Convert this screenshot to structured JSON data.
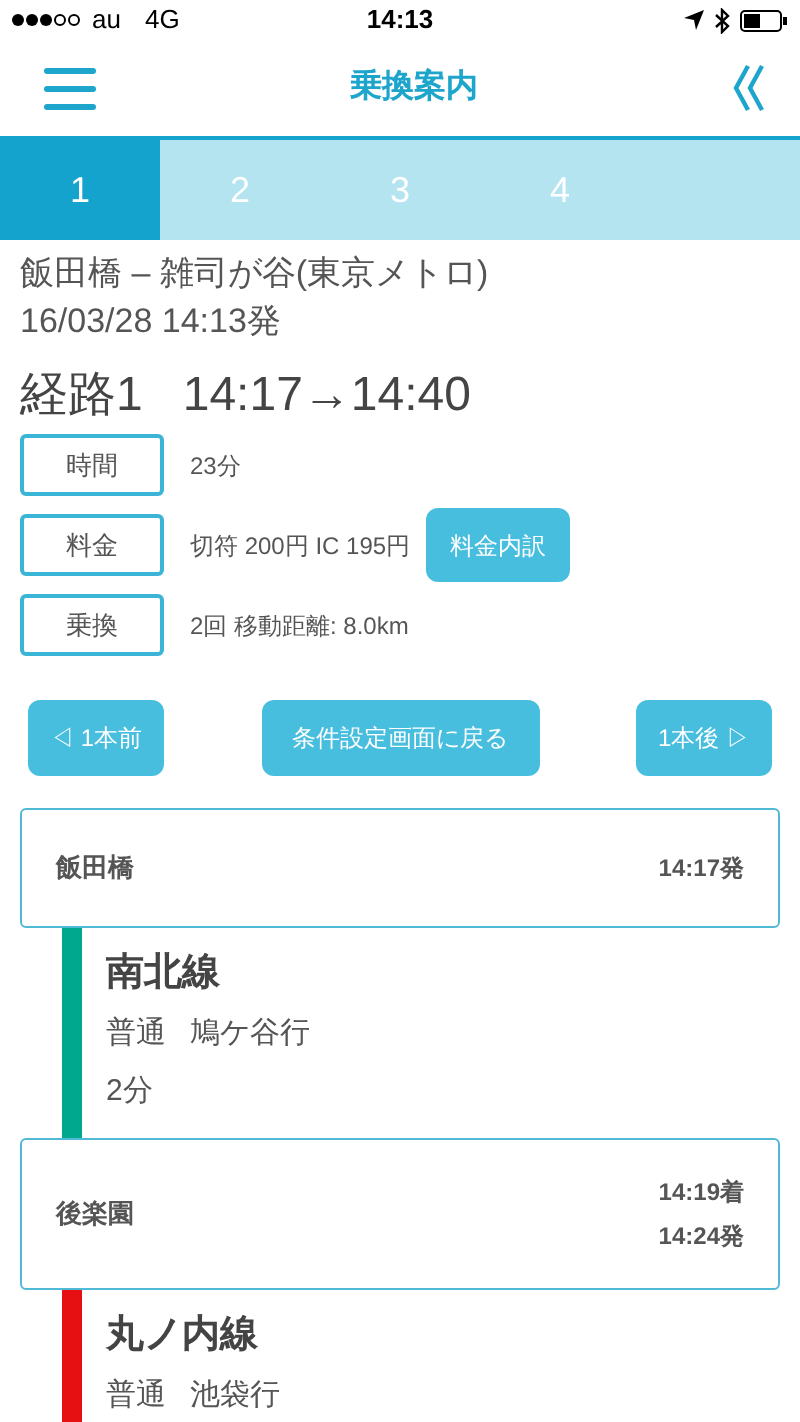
{
  "status_bar": {
    "carrier": "au",
    "network": "4G",
    "time": "14:13"
  },
  "header": {
    "title": "乗換案内"
  },
  "tabs": [
    {
      "label": "1",
      "selected": true
    },
    {
      "label": "2",
      "selected": false
    },
    {
      "label": "3",
      "selected": false
    },
    {
      "label": "4",
      "selected": false
    }
  ],
  "route": {
    "stations": "飯田橋 – 雑司が谷(東京メトロ)",
    "departure": "16/03/28 14:13発",
    "title": "経路1",
    "times": "14:17→14:40"
  },
  "details": [
    {
      "label": "時間",
      "value": "23分"
    },
    {
      "label": "料金",
      "value": "切符 200円 IC 195円",
      "button": "料金内訳"
    },
    {
      "label": "乗換",
      "value": "2回  移動距離: 8.0km"
    }
  ],
  "nav_buttons": {
    "previous": "◁ 1本前",
    "back": "条件設定画面に戻る",
    "next": "1本後 ▷"
  },
  "itinerary": [
    {
      "kind": "station",
      "name": "飯田橋",
      "times": [
        "14:17発"
      ]
    },
    {
      "kind": "leg",
      "line": "南北線",
      "color": "#00a88e",
      "service": "普通",
      "destination": "鳩ケ谷行",
      "duration": "2分"
    },
    {
      "kind": "station",
      "name": "後楽園",
      "times": [
        "14:19着",
        "14:24発"
      ]
    },
    {
      "kind": "leg",
      "line": "丸ノ内線",
      "color": "#e60f12",
      "service": "普通",
      "destination": "池袋行"
    }
  ]
}
